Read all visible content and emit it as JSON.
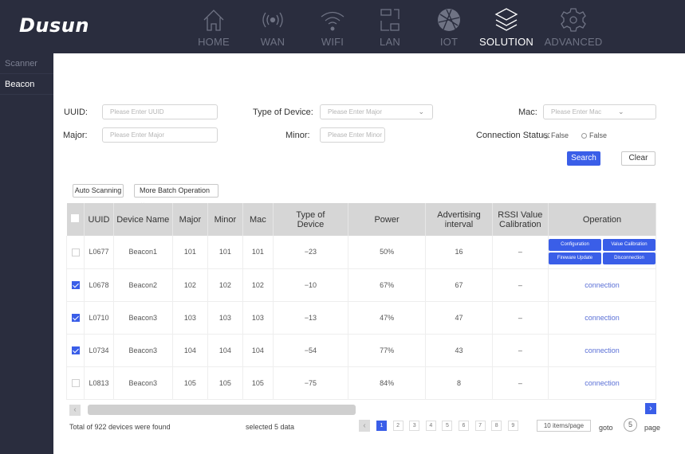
{
  "brand": {
    "logo": "Dusun"
  },
  "nav": [
    {
      "label": "HOME",
      "icon": "home-icon",
      "active": false
    },
    {
      "label": "WAN",
      "icon": "wan-icon",
      "active": false
    },
    {
      "label": "WIFI",
      "icon": "wifi-icon",
      "active": false
    },
    {
      "label": "LAN",
      "icon": "lan-icon",
      "active": false
    },
    {
      "label": "IOT",
      "icon": "iot-globe-icon",
      "active": false
    },
    {
      "label": "SOLUTION",
      "icon": "layers-icon",
      "active": true
    },
    {
      "label": "ADVANCED",
      "icon": "gear-icon",
      "active": false
    }
  ],
  "sidebar": {
    "items": [
      {
        "label": "Scanner",
        "active": false
      },
      {
        "label": "Beacon",
        "active": true
      }
    ]
  },
  "filters": {
    "uuid_label": "UUID:",
    "uuid_placeholder": "Please Enter UUID",
    "type_label": "Type of Device:",
    "type_placeholder": "Please Enter Major",
    "mac_label": "Mac:",
    "mac_placeholder": "Please Enter Mac",
    "major_label": "Major:",
    "major_placeholder": "Please Enter Major",
    "minor_label": "Minor:",
    "minor_placeholder": "Please Enter Minor",
    "conn_label": "Connection Status:",
    "conn_options": [
      "False",
      "False"
    ],
    "search_label": "Search",
    "clear_label": "Clear"
  },
  "toolbar": {
    "auto_scan_label": "Auto Scanning",
    "batch_label": "More Batch Operation"
  },
  "table": {
    "headers": [
      "UUID",
      "Device Name",
      "Major",
      "Minor",
      "Mac",
      "Type of Device",
      "Power",
      "Advertising interval",
      "RSSI Value Calibration",
      "Operation"
    ],
    "rows": [
      {
        "checked": false,
        "uuid": "L0677",
        "name": "Beacon1",
        "major": "101",
        "minor": "101",
        "mac": "101",
        "type": "−23",
        "power": "50%",
        "interval": "16",
        "rssi": "–",
        "operation": "buttons"
      },
      {
        "checked": true,
        "uuid": "L0678",
        "name": "Beacon2",
        "major": "102",
        "minor": "102",
        "mac": "102",
        "type": "−10",
        "power": "67%",
        "interval": "67",
        "rssi": "–",
        "operation": "connection"
      },
      {
        "checked": true,
        "uuid": "L0710",
        "name": "Beacon3",
        "major": "103",
        "minor": "103",
        "mac": "103",
        "type": "−13",
        "power": "47%",
        "interval": "47",
        "rssi": "–",
        "operation": "connection"
      },
      {
        "checked": true,
        "uuid": "L0734",
        "name": "Beacon3",
        "major": "104",
        "minor": "104",
        "mac": "104",
        "type": "−54",
        "power": "77%",
        "interval": "43",
        "rssi": "–",
        "operation": "connection"
      },
      {
        "checked": false,
        "uuid": "L0813",
        "name": "Beacon3",
        "major": "105",
        "minor": "105",
        "mac": "105",
        "type": "−75",
        "power": "84%",
        "interval": "8",
        "rssi": "–",
        "operation": "connection"
      }
    ],
    "op_buttons": [
      "Configuration",
      "Value Calibration",
      "Fireware Update",
      "Disconnection"
    ],
    "connection_label": "connection"
  },
  "footer": {
    "total": "Total of 922 devices  were found",
    "selected": "selected 5 data",
    "pages": [
      "1",
      "2",
      "3",
      "4",
      "5",
      "6",
      "7",
      "8",
      "9"
    ],
    "current_page": "1",
    "per_page": "10 items/page",
    "goto_label": "goto",
    "goto_value": "5",
    "page_label": "page"
  },
  "colors": {
    "primary": "#3a5ee8",
    "topbar": "#2a2d3e",
    "header_bg": "#d6d6d6"
  }
}
